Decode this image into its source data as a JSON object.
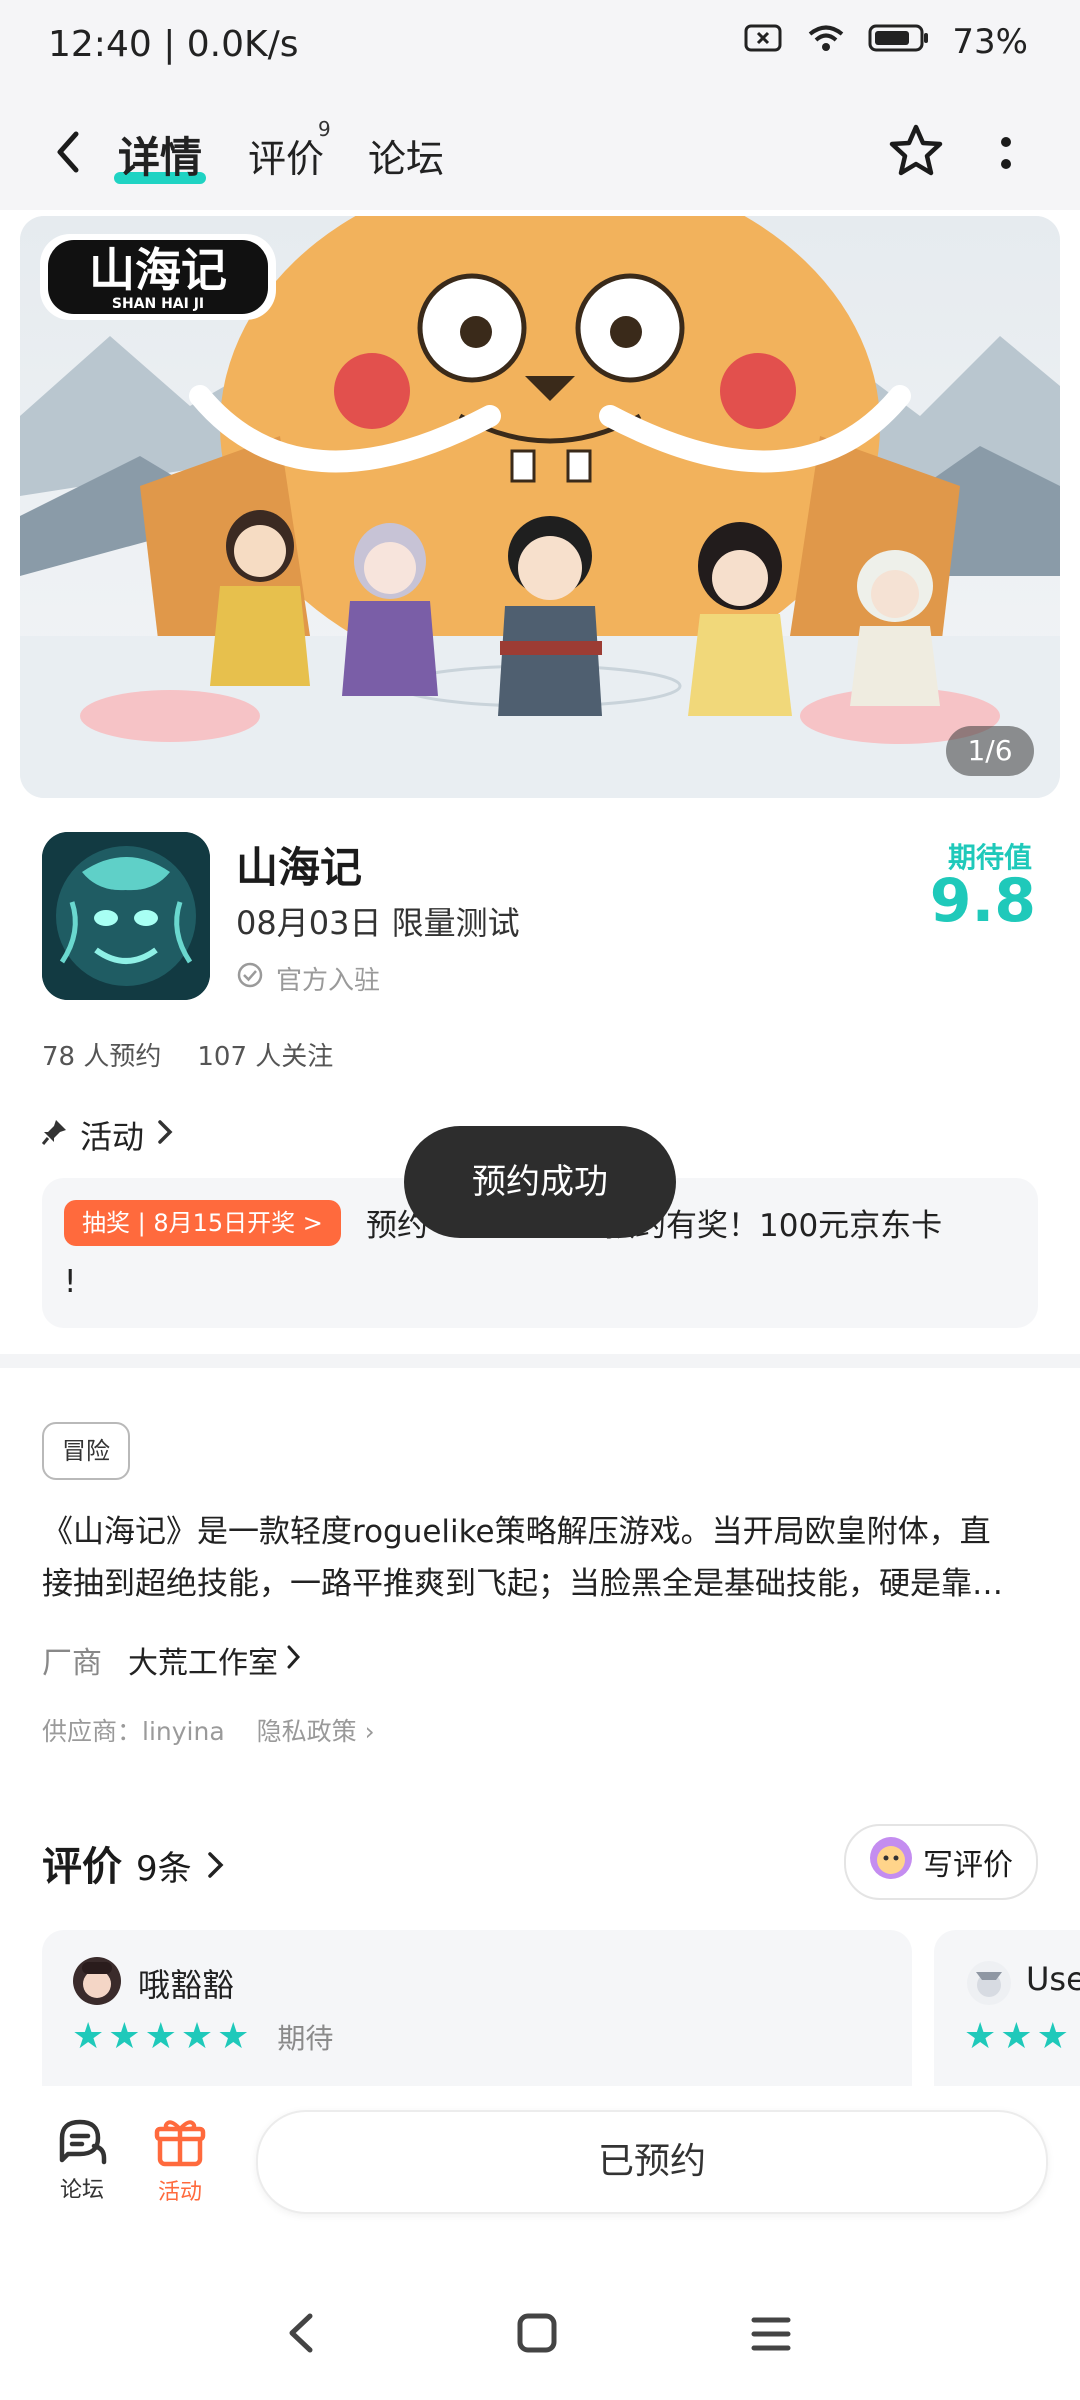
{
  "status_bar": {
    "time": "12:40 | 0.0K/s",
    "battery": "73%",
    "icons": [
      "sim-off-icon",
      "wifi-icon",
      "battery-icon"
    ]
  },
  "header": {
    "tabs": [
      {
        "label": "详情",
        "active": true
      },
      {
        "label": "评价",
        "badge": "9"
      },
      {
        "label": "论坛"
      }
    ],
    "icons": [
      "back-icon",
      "star-outline-icon",
      "more-icon"
    ]
  },
  "hero": {
    "logo_cn": "山海记",
    "logo_en": "SHAN HAI JI",
    "page_indicator": "1/6"
  },
  "app": {
    "name": "山海记",
    "date_status": "08月03日 限量测试",
    "verified": "官方入驻",
    "score_label": "期待值",
    "score": "9.8",
    "reservations": "78 人预约",
    "followers": "107 人关注"
  },
  "activity": {
    "title": "活动",
    "tag": "抽奖 | 8月15日开奖 >",
    "text_visible_start": "预约",
    "text_visible_end": "预约有奖！100元京东卡",
    "text_wrap": "!"
  },
  "toast": "预约成功",
  "info": {
    "genre": "冒险",
    "description_lines": [
      "《山海记》是一款轻度roguelike策略解压游戏。当开局欧皇附体，直",
      "接抽到超绝技能，一路平推爽到飞起；当脸黑全是基础技能，硬是靠…"
    ],
    "vendor_label": "厂商",
    "vendor_name": "大荒工作室",
    "supplier": "供应商：linyina",
    "privacy": "隐私政策"
  },
  "reviews": {
    "title": "评价",
    "count": "9条",
    "write_label": "写评价",
    "items": [
      {
        "name": "哦豁豁",
        "stars": 5,
        "tag": "期待"
      },
      {
        "name": "Use",
        "stars": 3,
        "tag": ""
      }
    ]
  },
  "bottom_bar": {
    "forum_label": "论坛",
    "activity_label": "活动",
    "reserve_label": "已预约"
  },
  "colors": {
    "accent": "#1fc9ba",
    "orange": "#ff6a3d",
    "toast_bg": "#2d2d2d"
  }
}
